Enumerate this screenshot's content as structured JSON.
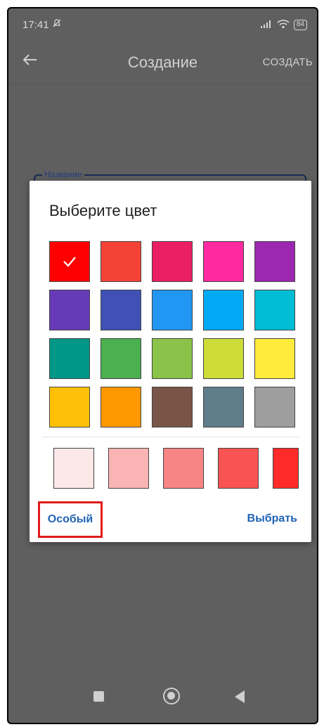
{
  "status_bar": {
    "time": "17:41",
    "battery": "84"
  },
  "app_bar": {
    "title": "Создание",
    "create_label": "СОЗДАТЬ"
  },
  "name_field": {
    "label": "Название"
  },
  "dialog": {
    "title": "Выберите цвет",
    "palette": [
      "#ff0000",
      "#f44336",
      "#e91e63",
      "#ff29a0",
      "#9c27b0",
      "#673ab7",
      "#3f51b5",
      "#2196f3",
      "#03a9f4",
      "#00bcd4",
      "#009688",
      "#4caf50",
      "#8bc34a",
      "#cddc39",
      "#ffeb3b",
      "#ffc107",
      "#ff9800",
      "#795548",
      "#607d8b",
      "#9e9e9e"
    ],
    "selected_index": 0,
    "shades": [
      "#fde8e8",
      "#fbb4b4",
      "#f88585",
      "#f95353",
      "#ff2a2a"
    ],
    "special_label": "Особый",
    "select_label": "Выбрать"
  },
  "colors": {
    "accent": "#1f63b5",
    "highlight": "#e01b1b"
  }
}
